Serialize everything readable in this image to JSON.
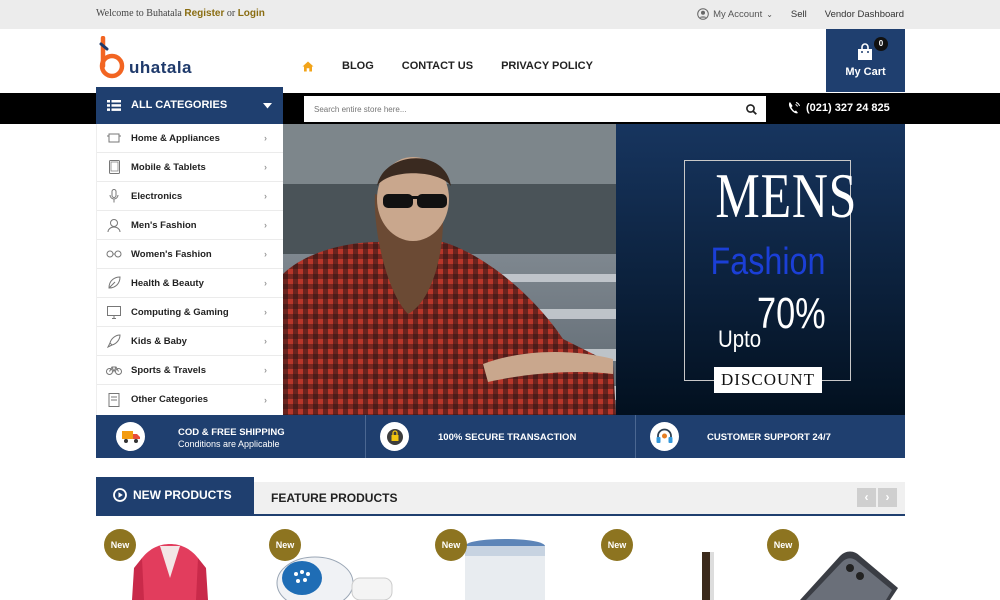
{
  "topbar": {
    "welcome": "Welcome to Buhatala",
    "register": "Register",
    "or": "or",
    "login": "Login",
    "my_account": "My Account",
    "sell": "Sell",
    "vendor_dashboard": "Vendor Dashboard"
  },
  "brand": {
    "logo_text": "uhatala",
    "logo_icon": "logo-b-icon",
    "accent": "#f26522",
    "primary": "#1f3f6f"
  },
  "nav": {
    "items": [
      {
        "icon": "home-icon"
      },
      {
        "label": "BLOG"
      },
      {
        "label": "CONTACT US"
      },
      {
        "label": "PRIVACY POLICY"
      }
    ]
  },
  "cart": {
    "count": "0",
    "label": "My Cart",
    "icon": "shopping-bag-icon"
  },
  "categories": {
    "title": "ALL CATEGORIES",
    "items": [
      {
        "label": "Home & Appliances",
        "icon": "appliance-icon"
      },
      {
        "label": "Mobile & Tablets",
        "icon": "tablet-icon"
      },
      {
        "label": "Electronics",
        "icon": "microphone-icon"
      },
      {
        "label": "Men's Fashion",
        "icon": "man-icon"
      },
      {
        "label": "Women's Fashion",
        "icon": "glasses-icon"
      },
      {
        "label": "Health & Beauty",
        "icon": "leaf-icon"
      },
      {
        "label": "Computing & Gaming",
        "icon": "monitor-icon"
      },
      {
        "label": "Kids & Baby",
        "icon": "rocket-icon"
      },
      {
        "label": "Sports & Travels",
        "icon": "bicycle-icon"
      },
      {
        "label": "Other Categories",
        "icon": "book-icon"
      }
    ]
  },
  "search": {
    "placeholder": "Search entire store here..."
  },
  "phone": {
    "number": "(021) 327 24 825"
  },
  "banner": {
    "line1": "MENS",
    "line2": "Fashion",
    "upto": "Upto",
    "percent": "70%",
    "discount": "DISCOUNT"
  },
  "features": [
    {
      "title": "COD & FREE SHIPPING",
      "subtitle": "Conditions are Applicable",
      "icon": "truck-icon"
    },
    {
      "title": "100% SECURE TRANSACTION",
      "icon": "lock-icon"
    },
    {
      "title": "CUSTOMER SUPPORT 24/7",
      "icon": "headset-icon"
    }
  ],
  "product_tabs": {
    "new": "NEW PRODUCTS",
    "feature": "FEATURE PRODUCTS",
    "prev": "‹",
    "next": "›"
  },
  "products": [
    {
      "badge": "New"
    },
    {
      "badge": "New"
    },
    {
      "badge": "New"
    },
    {
      "badge": "New"
    },
    {
      "badge": "New"
    }
  ]
}
